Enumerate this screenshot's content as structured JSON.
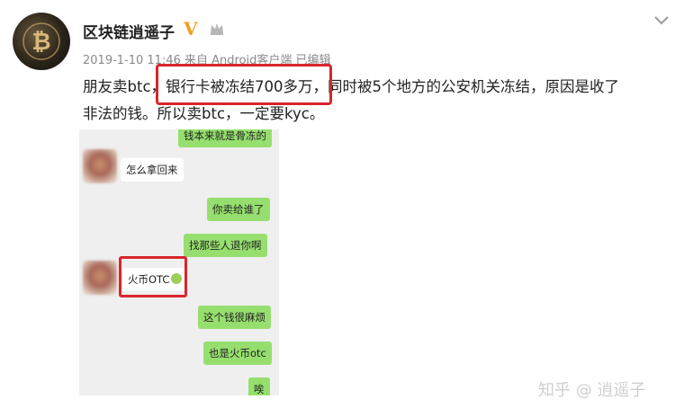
{
  "header": {
    "username": "区块链逍遥子",
    "verified_badge": "V",
    "crown_icon": "crown-icon",
    "more_icon": "chevron-down-icon",
    "meta": "2019-1-10 11:46 来自 Android客户端 已编辑"
  },
  "post": {
    "line1_prefix": "朋友卖btc，",
    "line1_highlight": "银行卡被冻结700多万",
    "line1_suffix": "，同时被5个地方的公安机关冻结，原因是收了",
    "line2": "非法的钱。所以卖btc，一定要kyc。"
  },
  "chat": {
    "messages": [
      {
        "side": "right",
        "text": "钱本来就是骨冻的"
      },
      {
        "side": "left",
        "text": "怎么拿回来"
      },
      {
        "side": "right",
        "text": "你卖给谁了"
      },
      {
        "side": "right",
        "text": "找那些人退你啊"
      },
      {
        "side": "left",
        "text": "火币OTC"
      },
      {
        "side": "right",
        "text": "这个钱很麻烦"
      },
      {
        "side": "right",
        "text": "也是火币otc"
      },
      {
        "side": "right",
        "text": "唉"
      }
    ]
  },
  "watermark": "知乎 @ 逍遥子",
  "colors": {
    "highlight_border": "#d9262c",
    "chat_green": "#96df6e",
    "chat_bg": "#efefef",
    "verified": "#f0a020"
  }
}
